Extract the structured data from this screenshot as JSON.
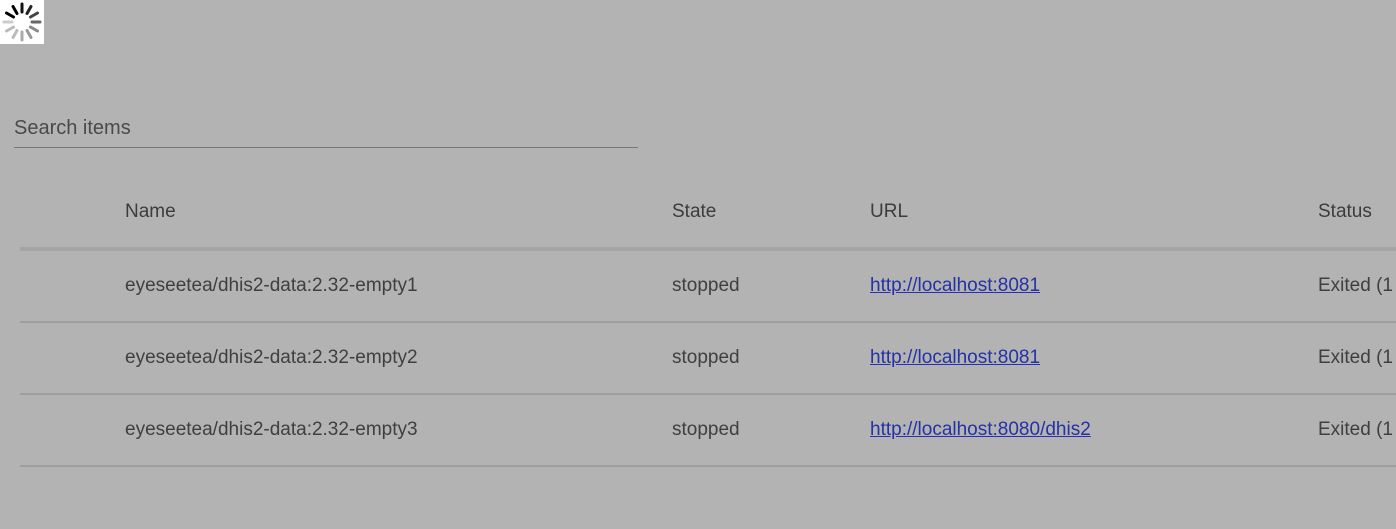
{
  "search": {
    "placeholder": "Search items"
  },
  "table": {
    "headers": {
      "name": "Name",
      "state": "State",
      "url": "URL",
      "status": "Status"
    },
    "rows": [
      {
        "name": "eyeseetea/dhis2-data:2.32-empty1",
        "state": "stopped",
        "url": "http://localhost:8081",
        "status": "Exited (1"
      },
      {
        "name": "eyeseetea/dhis2-data:2.32-empty2",
        "state": "stopped",
        "url": "http://localhost:8081",
        "status": "Exited (1"
      },
      {
        "name": "eyeseetea/dhis2-data:2.32-empty3",
        "state": "stopped",
        "url": "http://localhost:8080/dhis2",
        "status": "Exited (1"
      }
    ]
  }
}
